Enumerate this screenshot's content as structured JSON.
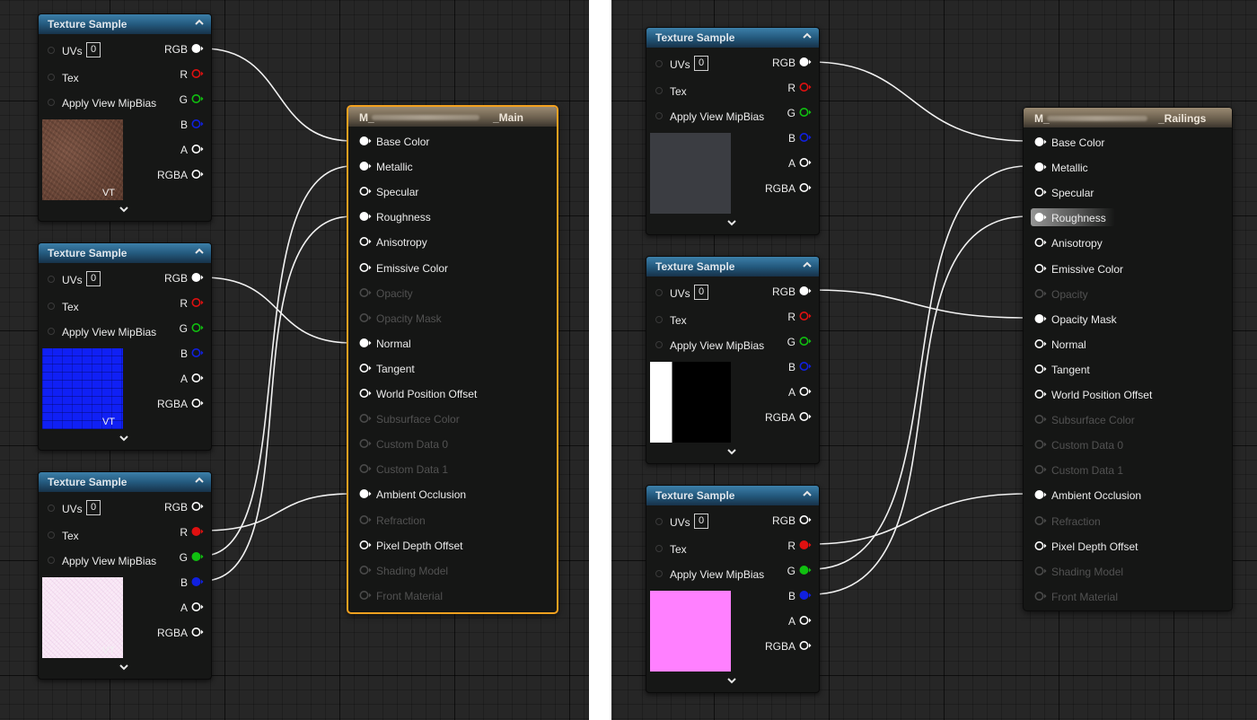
{
  "texture_node": {
    "title": "Texture Sample",
    "inputs": {
      "uvs": "UVs",
      "uvs_value": "0",
      "tex": "Tex",
      "mipbias": "Apply View MipBias"
    },
    "outputs": {
      "rgb": "RGB",
      "r": "R",
      "g": "G",
      "b": "B",
      "a": "A",
      "rgba": "RGBA"
    },
    "vt_badge": "VT"
  },
  "material_inputs": [
    {
      "label": "Base Color",
      "enabled": true
    },
    {
      "label": "Metallic",
      "enabled": true
    },
    {
      "label": "Specular",
      "enabled": true
    },
    {
      "label": "Roughness",
      "enabled": true
    },
    {
      "label": "Anisotropy",
      "enabled": true
    },
    {
      "label": "Emissive Color",
      "enabled": true
    },
    {
      "label": "Opacity",
      "enabled": false
    },
    {
      "label": "Opacity Mask",
      "enabled": false
    },
    {
      "label": "Normal",
      "enabled": true
    },
    {
      "label": "Tangent",
      "enabled": true
    },
    {
      "label": "World Position Offset",
      "enabled": true
    },
    {
      "label": "Subsurface Color",
      "enabled": false
    },
    {
      "label": "Custom Data 0",
      "enabled": false
    },
    {
      "label": "Custom Data 1",
      "enabled": false
    },
    {
      "label": "Ambient Occlusion",
      "enabled": true
    },
    {
      "label": "Refraction",
      "enabled": false
    },
    {
      "label": "Pixel Depth Offset",
      "enabled": true
    },
    {
      "label": "Shading Model",
      "enabled": false
    },
    {
      "label": "Front Material",
      "enabled": false
    }
  ],
  "left": {
    "material": {
      "title_prefix": "M_",
      "title_suffix": "_Main",
      "selected": true
    },
    "textures": [
      {
        "preview": "brown-noise",
        "vt": true
      },
      {
        "preview": "blue-normal",
        "vt": true
      },
      {
        "preview": "pink-noise",
        "vt": true
      }
    ]
  },
  "right": {
    "material": {
      "title_prefix": "M_",
      "title_suffix": "_Railings",
      "selected": false,
      "enabled_overrides": {
        "Opacity Mask": true
      }
    },
    "textures": [
      {
        "preview": "dark-gray",
        "vt": false
      },
      {
        "preview": "white-black-mask",
        "vt": false
      },
      {
        "preview": "magenta",
        "vt": false
      }
    ]
  },
  "colors": {
    "graph_bg": "#262626",
    "texture_header": "#245a7e",
    "material_header": "#6c604e",
    "selection": "#f3a11f",
    "wire": "#f2f2f2",
    "pin_r": "#e01010",
    "pin_g": "#10c010",
    "pin_b": "#1020e0"
  }
}
